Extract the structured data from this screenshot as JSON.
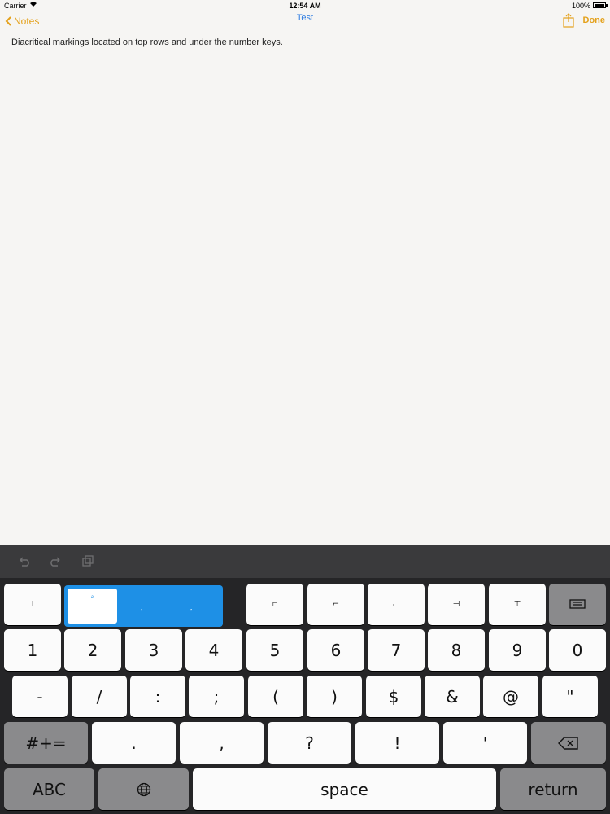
{
  "status": {
    "carrier": "Carrier",
    "time": "12:54 AM",
    "battery": "100%"
  },
  "nav": {
    "back": "Notes",
    "title": "Test",
    "done": "Done"
  },
  "note": {
    "text": "Diacritical markings located on top rows and under the number keys."
  },
  "toolbar": {
    "icons": [
      "undo-icon",
      "redo-icon",
      "paste-icon"
    ]
  },
  "popup": {
    "selected": "²",
    "options": [
      "‚",
      "‚"
    ]
  },
  "keys": {
    "row0": [
      "⊥",
      "",
      "",
      "",
      "▫",
      "⌐",
      "⌴",
      "⊣",
      "⊤"
    ],
    "row1": [
      "1",
      "2",
      "3",
      "4",
      "5",
      "6",
      "7",
      "8",
      "9",
      "0"
    ],
    "row2": [
      "-",
      "/",
      ":",
      ";",
      "(",
      ")",
      "$",
      "&",
      "@",
      "\""
    ],
    "row3": [
      "#+=",
      ".",
      ",",
      "?",
      "!",
      "'"
    ],
    "row4": {
      "abc": "ABC",
      "space": "space",
      "return": "return"
    }
  },
  "colors": {
    "accent": "#e4a11b",
    "title": "#2f7de1",
    "popup": "#1e90e6"
  }
}
